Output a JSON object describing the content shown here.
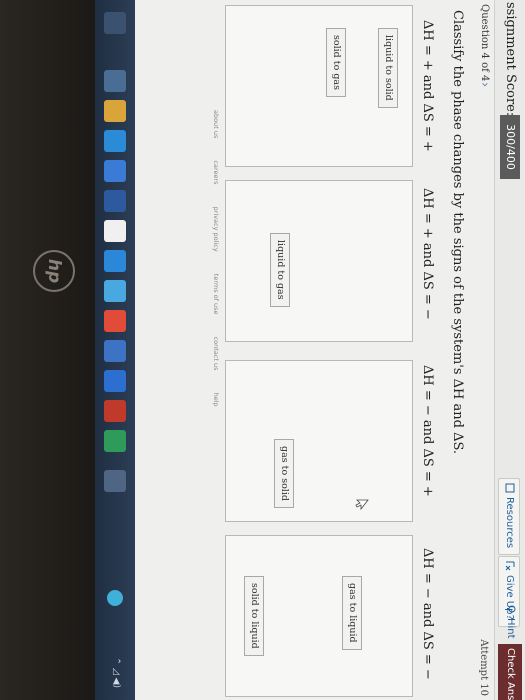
{
  "header": {
    "score_label": "ssignment Score:",
    "score_value": "300/400",
    "resources_label": "Resources",
    "give_up_label": "Give Up?",
    "hint_label": "Hint",
    "check_answer_label": "Check Answe"
  },
  "question": {
    "counter": "Question 4 of 4",
    "attempt": "Attempt 10",
    "prompt": "Classify the phase changes by the signs of the system's ΔH and ΔS."
  },
  "columns": [
    {
      "heading": "ΔH = + and ΔS = +",
      "items": [
        "liquid to solid",
        "solid to gas"
      ]
    },
    {
      "heading": "ΔH = + and ΔS = −",
      "items": [
        "liquid to gas"
      ]
    },
    {
      "heading": "ΔH = − and ΔS = +",
      "items": [
        "gas to solid"
      ]
    },
    {
      "heading": "ΔH = − and ΔS = −",
      "items": [
        "solid to liquid",
        "gas to liquid"
      ]
    }
  ],
  "footer": {
    "links": [
      "about us",
      "careers",
      "privacy policy",
      "terms of use",
      "contact us",
      "help"
    ]
  },
  "device": {
    "logo_text": "hp"
  },
  "colors": {
    "check_button": "#6b2d2d",
    "score_box": "#5b5b5b",
    "link": "#1f5f9a",
    "taskbar": "#26374c"
  }
}
